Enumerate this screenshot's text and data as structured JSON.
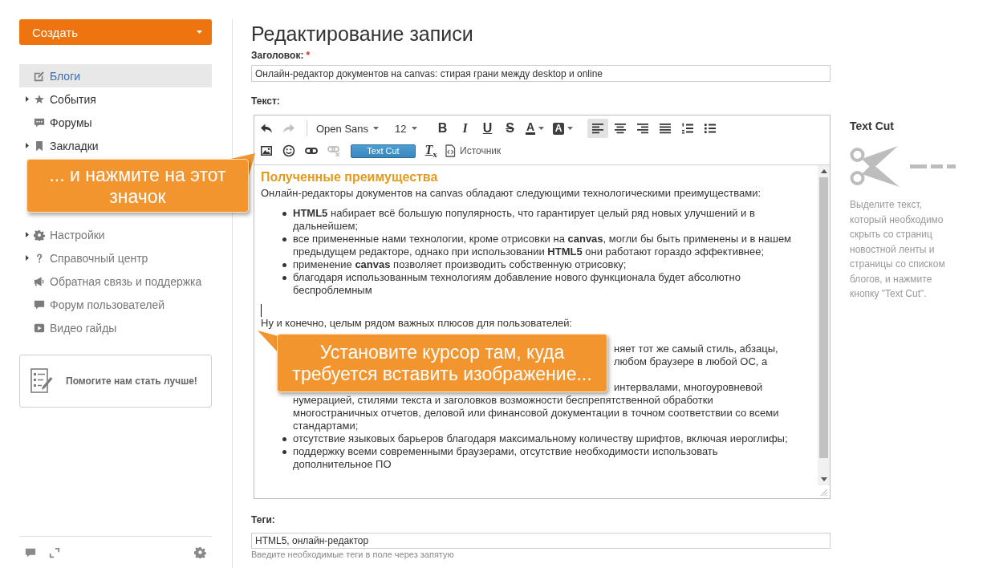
{
  "sidebar": {
    "create_button": {
      "label": "Создать"
    },
    "nav_items": [
      {
        "label": "Блоги",
        "expandable": false,
        "selected": true
      },
      {
        "label": "События",
        "expandable": true,
        "selected": false
      },
      {
        "label": "Форумы",
        "expandable": false,
        "selected": false
      },
      {
        "label": "Закладки",
        "expandable": true,
        "selected": false
      }
    ],
    "help_items": [
      {
        "label": "Настройки",
        "expandable": true,
        "selected": false
      },
      {
        "label": "Справочный центр",
        "expandable": true,
        "selected": false
      },
      {
        "label": "Обратная связь и поддержка",
        "expandable": false,
        "selected": false
      },
      {
        "label": "Форум пользователей",
        "expandable": false,
        "selected": false
      },
      {
        "label": "Видео гайды",
        "expandable": false,
        "selected": false
      }
    ],
    "feedback_card": {
      "label": "Помогите нам стать лучше!"
    }
  },
  "editor": {
    "title": "Редактирование записи",
    "title_field": {
      "label": "Заголовок:",
      "required_mark": "*",
      "value": "Онлайн-редактор документов на canvas: стирая грани между desktop и online"
    },
    "text_label": "Текст:",
    "toolbar": [
      {
        "groups": [
          {
            "items": [
              {
                "kind": "undo",
                "disabled": false,
                "active": false
              },
              {
                "kind": "redo",
                "disabled": true,
                "active": false
              }
            ]
          },
          {
            "items": [
              {
                "kind": "font",
                "label": "Open Sans",
                "disabled": false,
                "active": false
              },
              {
                "kind": "size",
                "label": "12",
                "disabled": false,
                "active": false
              },
              {
                "kind": "bold",
                "label": "B",
                "disabled": false,
                "active": false
              },
              {
                "kind": "italic",
                "label": "I",
                "disabled": false,
                "active": false
              },
              {
                "kind": "underline",
                "label": "U",
                "disabled": false,
                "active": false
              },
              {
                "kind": "strike",
                "label": "S",
                "disabled": false,
                "active": false
              },
              {
                "kind": "font-color",
                "label": "A",
                "disabled": false,
                "active": false
              },
              {
                "kind": "highlight",
                "label": "A",
                "disabled": false,
                "active": false
              },
              {
                "kind": "align-left",
                "disabled": false,
                "active": true
              },
              {
                "kind": "align-center",
                "disabled": false,
                "active": false
              },
              {
                "kind": "align-right",
                "disabled": false,
                "active": false
              },
              {
                "kind": "justify",
                "disabled": false,
                "active": false
              },
              {
                "kind": "numbered-list",
                "disabled": false,
                "active": false
              },
              {
                "kind": "bulleted-list",
                "disabled": false,
                "active": false
              }
            ]
          }
        ]
      },
      {
        "groups": [
          {
            "items": [
              {
                "kind": "image",
                "disabled": false,
                "active": false
              },
              {
                "kind": "emoji",
                "disabled": false,
                "active": false
              },
              {
                "kind": "link",
                "disabled": false,
                "active": false
              },
              {
                "kind": "unlink",
                "disabled": true,
                "active": false
              },
              {
                "kind": "text-cut",
                "label": "Text Cut",
                "disabled": false,
                "active": false
              },
              {
                "kind": "clear-format",
                "label": "T$_{x}$",
                "disabled": false,
                "active": false
              },
              {
                "kind": "source",
                "label": "Источник",
                "disabled": false,
                "active": false
              }
            ]
          }
        ]
      }
    ],
    "content": {
      "heading": "Полученные преимущества",
      "intro": "Онлайн-редакторы документов на canvas обладают следующими технологическими преимуществами:",
      "list_1": [
        "**HTML5** набирает всё большую популярность, что гарантирует целый ряд новых улучшений и в дальнейшем;",
        "все примененные нами технологии, кроме отрисовки на **canvas**, могли бы быть применены и в нашем предыдущем редакторе, однако при использовании **HTML5** они работают гораздо эффективнее;",
        "применение **canvas** позволяет производить собственную отрисовку;",
        "благодаря использованным технологиям добавление нового функционала будет абсолютно беспроблемным"
      ],
      "outro": "Ну и конечно, целым рядом важных плюсов для пользователей:",
      "covered_line_ends": [
        "няет тот же самый стиль, абзацы,",
        "любом браузере в любой ОС, а",
        "интервалами, многоуровневой"
      ],
      "covered_continuation": "нумерацией, стилями текста и заголовков возможности беспрепятственной обработки многостраничных отчетов, деловой или финансовой документации в точном соответствии со всеми стандартами;",
      "list_2": [
        "отсутствие языковых барьеров благодаря максимальному количеству шрифтов, включая иероглифы;",
        "поддержку всеми современными браузерами, отсутствие необходимости использовать дополнительное ПО"
      ]
    },
    "tags_field": {
      "label": "Теги:",
      "value": "HTML5, онлайн-редактор",
      "help_text": "Введите необходимые теги в поле через запятую"
    }
  },
  "text_cut_panel": {
    "title": "Text Cut",
    "description": "Выделите текст, который необходимо скрыть со страниц новостной ленты и страницы со списком блогов, и нажмите кнопку \"Text Cut\"."
  },
  "callouts": [
    {
      "text": "... и нажмите на этот значок"
    },
    {
      "text": "Установите курсор там, куда требуется вставить изображение..."
    }
  ]
}
